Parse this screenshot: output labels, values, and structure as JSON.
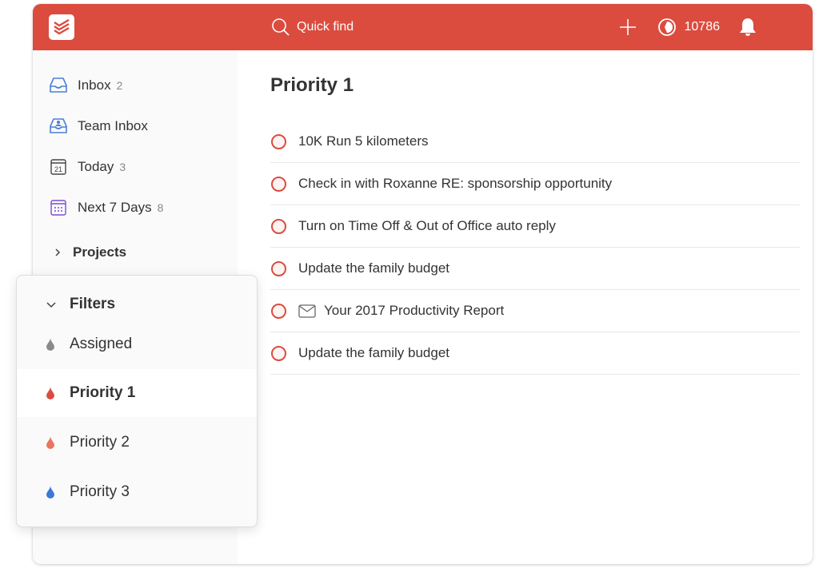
{
  "topbar": {
    "search_placeholder": "Quick find",
    "karma_score": "10786",
    "brand_color": "#db4c3f",
    "icons": [
      "todoist-logo-icon",
      "search-icon",
      "plus-icon",
      "karma-icon",
      "bell-icon"
    ]
  },
  "sidebar": {
    "items": [
      {
        "label": "Inbox",
        "count": "2",
        "icon": "inbox-icon"
      },
      {
        "label": "Team Inbox",
        "count": "",
        "icon": "team-inbox-icon"
      },
      {
        "label": "Today",
        "count": "3",
        "icon": "calendar-today-icon",
        "day": "21"
      },
      {
        "label": "Next 7 Days",
        "count": "8",
        "icon": "calendar-week-icon"
      }
    ],
    "projects_label": "Projects"
  },
  "filters": {
    "header": "Filters",
    "items": [
      {
        "label": "Assigned",
        "color": "#8a8a8a",
        "active": false
      },
      {
        "label": "Priority 1",
        "color": "#db4c3f",
        "active": true
      },
      {
        "label": "Priority 2",
        "color": "#e8765e",
        "active": false
      },
      {
        "label": "Priority 3",
        "color": "#3c78d8",
        "active": false
      }
    ]
  },
  "main": {
    "title": "Priority 1",
    "tasks": [
      {
        "text": "10K Run 5 kilometers",
        "has_mail_icon": false
      },
      {
        "text": "Check in with Roxanne RE: sponsorship opportunity",
        "has_mail_icon": false
      },
      {
        "text": "Turn on Time Off & Out of Office auto reply",
        "has_mail_icon": false
      },
      {
        "text": "Update the family budget",
        "has_mail_icon": false
      },
      {
        "text": "Your 2017 Productivity Report",
        "has_mail_icon": true
      },
      {
        "text": "Update the family budget",
        "has_mail_icon": false
      }
    ]
  }
}
